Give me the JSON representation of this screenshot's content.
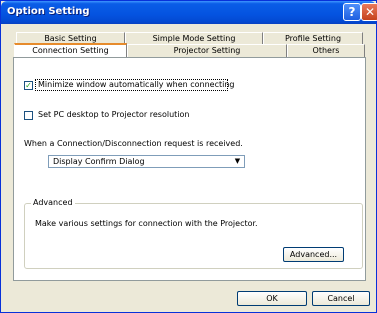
{
  "window": {
    "title": "Option Setting"
  },
  "titlebar": {
    "help_glyph": "?",
    "close_glyph": "✕"
  },
  "tabs_row1": [
    {
      "label": "Basic Setting"
    },
    {
      "label": "Simple Mode Setting"
    },
    {
      "label": "Profile Setting"
    }
  ],
  "tabs_row2": [
    {
      "label": "Connection Setting"
    },
    {
      "label": "Projector Setting"
    },
    {
      "label": "Others"
    }
  ],
  "options": {
    "minimize_label": "Minimize window automatically when connecting",
    "minimize_checked": true,
    "minimize_check_glyph": "✓",
    "desktop_label": "Set PC desktop to Projector resolution",
    "desktop_checked": false
  },
  "request": {
    "label": "When a Connection/Disconnection request is received.",
    "selected": "Display Confirm Dialog",
    "arrow_glyph": "▼"
  },
  "advanced": {
    "group_title": "Advanced",
    "description": "Make various settings for connection with the Projector.",
    "button_label": "Advanced..."
  },
  "footer": {
    "ok_label": "OK",
    "cancel_label": "Cancel"
  }
}
